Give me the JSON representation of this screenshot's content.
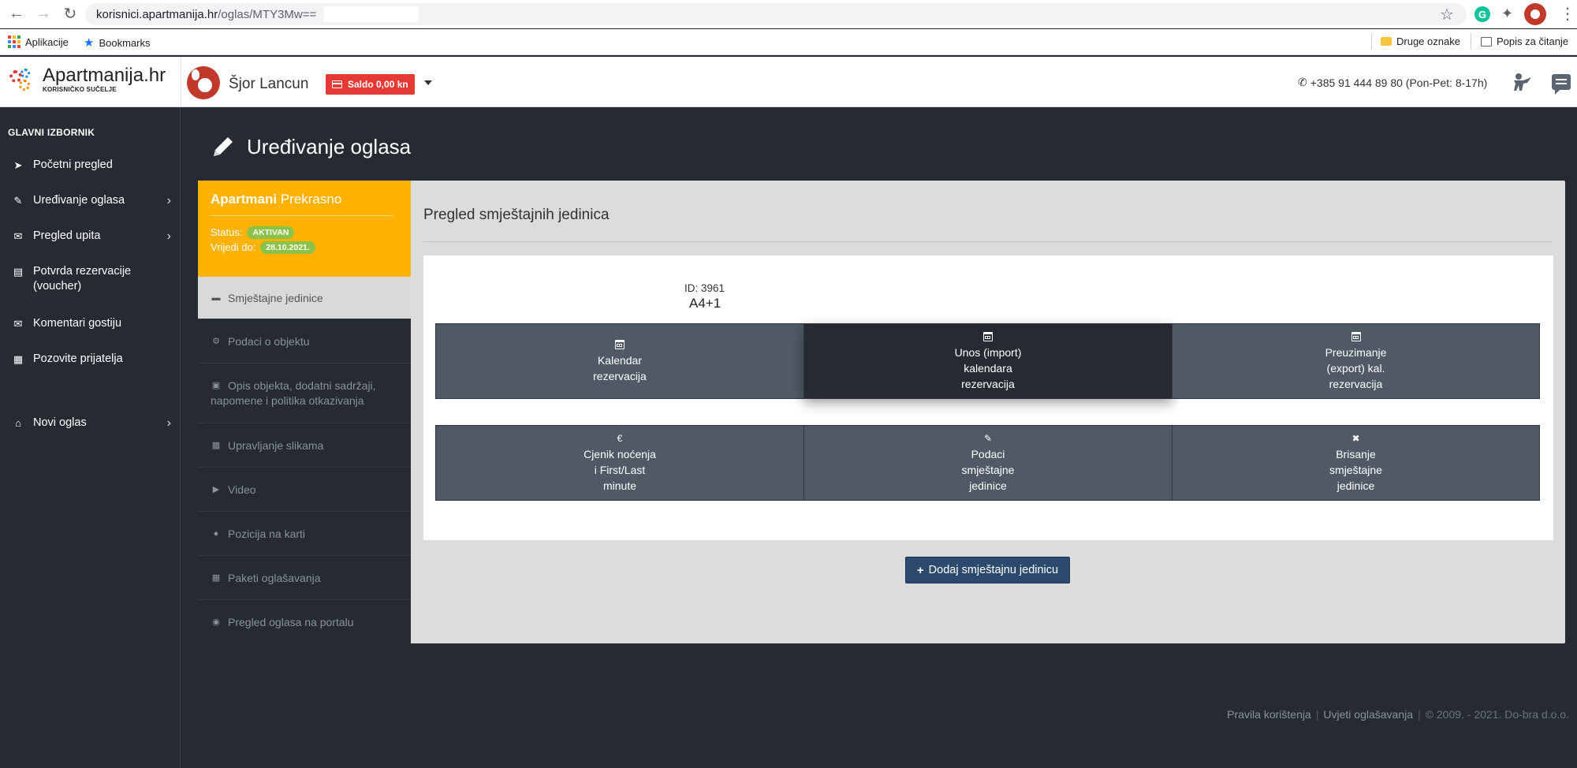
{
  "browser": {
    "url_domain": "korisnici.apartmanija.hr",
    "url_path": "/oglas/MTY3Mw==",
    "bookmarks": [
      {
        "label": "Aplikacije"
      },
      {
        "label": "Bookmarks"
      }
    ],
    "right_bookmarks": [
      {
        "label": "Druge oznake"
      },
      {
        "label": "Popis za čitanje"
      }
    ]
  },
  "header": {
    "logo_title": "Apartmanija.hr",
    "logo_subtitle": "KORISNIČKO SUČELJE",
    "user_name": "Šjor Lancun",
    "saldo_label": "Saldo 0,00 kn",
    "phone": "+385 91 444 89 80 (Pon-Pet: 8-17h)",
    "accent_color": "#e53935"
  },
  "sidebar": {
    "heading": "GLAVNI IZBORNIK",
    "items": [
      {
        "label": "Početni pregled",
        "icon": "rocket-icon"
      },
      {
        "label": "Uređivanje oglasa",
        "icon": "pencil-icon"
      },
      {
        "label": "Pregled upita",
        "icon": "envelope-icon"
      },
      {
        "label": "Potvrda rezervacije (voucher)",
        "icon": "id-card-icon"
      },
      {
        "label": "Komentari gostiju",
        "icon": "comments-icon"
      },
      {
        "label": "Pozovite prijatelja",
        "icon": "gift-icon"
      },
      {
        "label": "Novi oglas",
        "icon": "home-icon"
      }
    ]
  },
  "page": {
    "title": "Uređivanje oglasa"
  },
  "listing": {
    "name_bold": "Apartmani",
    "name_rest": "Prekrasno",
    "status_label": "Status:",
    "status_value": "AKTIVAN",
    "valid_label": "Vrijedi do:",
    "valid_value": "28.10.2021.",
    "color": "#ffb300"
  },
  "listing_nav": [
    {
      "label": "Smještajne jedinice",
      "icon": "bed-icon"
    },
    {
      "label": "Podaci o objektu",
      "icon": "gear-icon"
    },
    {
      "label": "Opis objekta, dodatni sadržaji, napomene i politika otkazivanja",
      "icon": "book-icon"
    },
    {
      "label": "Upravljanje slikama",
      "icon": "image-icon"
    },
    {
      "label": "Video",
      "icon": "video-icon"
    },
    {
      "label": "Pozicija na karti",
      "icon": "map-marker-icon"
    },
    {
      "label": "Paketi oglašavanja",
      "icon": "cubes-icon"
    },
    {
      "label": "Pregled oglasa na portalu",
      "icon": "binoculars-icon"
    }
  ],
  "content": {
    "title": "Pregled smještajnih jedinica",
    "unit_id": "ID: 3961",
    "unit_name": "A4+1",
    "tiles": [
      {
        "label_lines": [
          "Kalendar",
          "rezervacija"
        ],
        "icon": "calendar-icon"
      },
      {
        "label_lines": [
          "Unos (import)",
          "kalendara",
          "rezervacija"
        ],
        "icon": "calendar-icon"
      },
      {
        "label_lines": [
          "Preuzimanje",
          "(export) kal.",
          "rezervacija"
        ],
        "icon": "calendar-icon"
      },
      {
        "label_lines": [
          "Cjenik noćenja",
          "i First/Last",
          "minute"
        ],
        "icon": "euro-icon"
      },
      {
        "label_lines": [
          "Podaci",
          "smještajne",
          "jedinice"
        ],
        "icon": "pencil-icon"
      },
      {
        "label_lines": [
          "Brisanje",
          "smještajne",
          "jedinice"
        ],
        "icon": "close-icon"
      }
    ],
    "add_button": "Dodaj smještajnu jedinicu"
  },
  "footer": {
    "link1": "Pravila korištenja",
    "link2": "Uvjeti oglašavanja",
    "copyright": "© 2009. - 2021. Do-bra d.o.o."
  }
}
